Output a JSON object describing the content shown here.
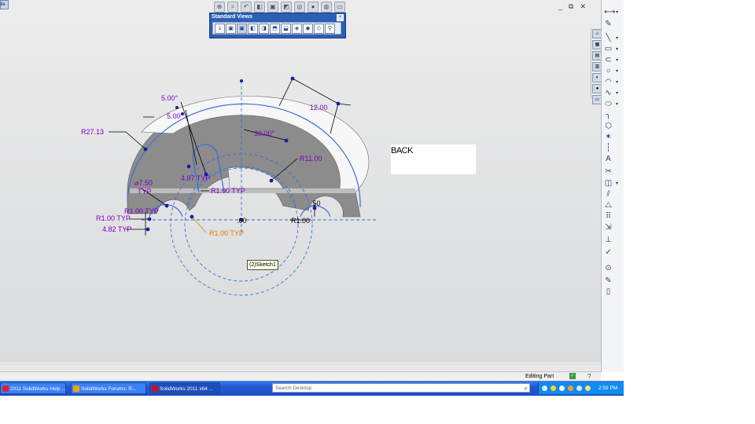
{
  "corner_tag": "lis",
  "view_toolbar": {
    "icons": [
      "zoom-to-fit-icon",
      "zoom-area-icon",
      "previous-view-icon",
      "section-view-icon",
      "view-orientation-icon",
      "display-style-icon",
      "hide-show-icon",
      "edit-appearance-icon",
      "apply-scene-icon",
      "view-settings-icon"
    ]
  },
  "window_controls": {
    "minimize": "_",
    "restore": "⧉",
    "close": "✕"
  },
  "standard_views": {
    "title": "Standard Views",
    "close": "×",
    "icons": [
      "normal-to-icon",
      "front-icon",
      "back-icon",
      "left-icon",
      "right-icon",
      "top-icon",
      "bottom-icon",
      "isometric-icon",
      "trimetric-icon",
      "dimetric-icon",
      "link-view-icon"
    ]
  },
  "viewport_label": {
    "text": "BACK"
  },
  "sketch_tag": "(2)Sketch1",
  "dimensions": {
    "angle_top": "5.00°",
    "angle_mid": "5.00°",
    "radius_outer": "R27.13",
    "length_top_right": "12.00",
    "angle_30": "30.00°",
    "radius_11": "R11.00",
    "typ_497": "4.97 TYP",
    "radius_1_typ_center": "R1.00 TYP",
    "diameter_750": "⌀7.50",
    "typ_word": "TYP",
    "radius_1_left_typ": "R1.00 TYP",
    "radius_1_left_typ2": "R1.00 TYP",
    "typ_482": "4.82 TYP",
    "radius_1_orange": "R1.00 TYP",
    "radius_1_bottom": "R1.00",
    "dim_50": ".50",
    "dim_00": ".00"
  },
  "colors": {
    "dimension": "#7a00c8",
    "driven_dimension": "#e07800",
    "sketch_line": "#3a6fd8",
    "part_face": "#8c8c8c",
    "taskbar": "#2159d3"
  },
  "right_toolbar": {
    "icons": [
      "smart-dimension-icon",
      "sketch-icon",
      "line-icon",
      "rectangle-icon",
      "slot-icon",
      "circle-icon",
      "arc-icon",
      "spline-icon",
      "ellipse-icon",
      "fillet-icon",
      "polygon-icon",
      "point-icon",
      "centerline-icon",
      "text-icon",
      "trim-icon",
      "convert-entities-icon",
      "offset-icon",
      "mirror-icon",
      "linear-pattern-icon",
      "move-entities-icon",
      "relations-icon",
      "repair-sketch-icon",
      "quick-snaps-icon",
      "rapid-sketch-icon",
      "instant2d-icon"
    ]
  },
  "left_strip": {
    "icons": [
      "home-icon",
      "resources-icon",
      "design-library-icon",
      "file-explorer-icon",
      "view-palette-icon",
      "appearances-icon",
      "custom-properties-icon"
    ]
  },
  "status_bar": {
    "text": "Editing Part",
    "help": "?"
  },
  "taskbar": {
    "buttons": [
      {
        "label": "2011 SolidWorks Help ...",
        "icon_color": "#d8262f"
      },
      {
        "label": "SolidWorks Forums: R...",
        "icon_color": "#e8a319"
      },
      {
        "label": "SolidWorks 2011 x64 ...",
        "icon_color": "#c8102e"
      }
    ],
    "search_placeholder": "Search Desktop",
    "clock": "2:59 PM"
  }
}
